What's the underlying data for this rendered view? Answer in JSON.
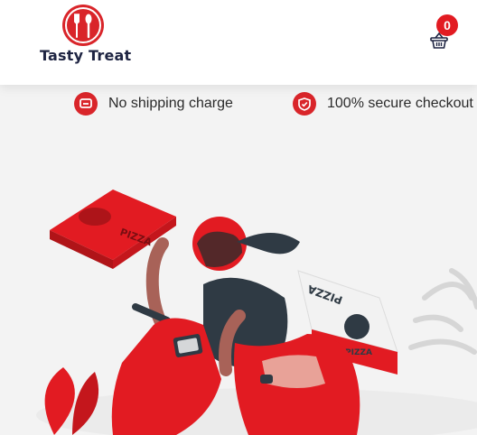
{
  "brand": {
    "name": "Tasty Treat"
  },
  "cart": {
    "count": "0"
  },
  "features": [
    {
      "label": "No shipping charge",
      "icon": "truck-icon"
    },
    {
      "label": "100% secure checkout",
      "icon": "shield-icon"
    }
  ],
  "hero": {
    "box_text_1": "PIZZA",
    "box_text_2": "PIZZA",
    "box_text_3": "PIZZA"
  },
  "colors": {
    "accent": "#e21b22",
    "dark": "#1e2442",
    "background": "#f3f3f3"
  }
}
